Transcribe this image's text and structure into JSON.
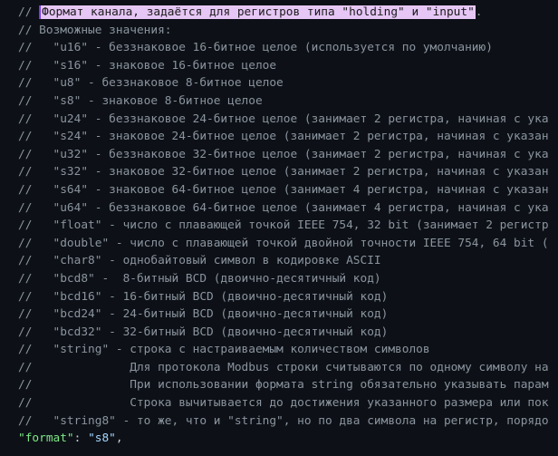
{
  "code": {
    "first_line": {
      "prefix": "// ",
      "highlighted": "Формат канала, задаётся для регистров типа \"holding\" и \"input\"",
      "suffix": "."
    },
    "comment_lines": [
      "// Возможные значения:",
      "//   \"u16\" - беззнаковое 16-битное целое (используется по умолчанию)",
      "//   \"s16\" - знаковое 16-битное целое",
      "//   \"u8\" - беззнаковое 8-битное целое",
      "//   \"s8\" - знаковое 8-битное целое",
      "//   \"u24\" - беззнаковое 24-битное целое (занимает 2 регистра, начиная с ука",
      "//   \"s24\" - знаковое 24-битное целое (занимает 2 регистра, начиная с указан",
      "//   \"u32\" - беззнаковое 32-битное целое (занимает 2 регистра, начиная с ука",
      "//   \"s32\" - знаковое 32-битное целое (занимает 2 регистра, начиная с указан",
      "//   \"s64\" - знаковое 64-битное целое (занимает 4 регистра, начиная с указан",
      "//   \"u64\" - беззнаковое 64-битное целое (занимает 4 регистра, начиная с ука",
      "//   \"float\" - число с плавающей точкой IEEE 754, 32 bit (занимает 2 регистр",
      "//   \"double\" - число с плавающей точкой двойной точности IEEE 754, 64 bit (",
      "//   \"char8\" - однобайтовый символ в кодировке ASCII",
      "//   \"bcd8\" -  8-битный BCD (двоично-десятичный код)",
      "//   \"bcd16\" - 16-битный BCD (двоично-десятичный код)",
      "//   \"bcd24\" - 24-битный BCD (двоично-десятичный код)",
      "//   \"bcd32\" - 32-битный BCD (двоично-десятичный код)",
      "//   \"string\" - строка с настраиваемым количеством символов",
      "//              Для протокола Modbus строки считываются по одному символу на",
      "//              При использовании формата string обязательно указывать парам",
      "//              Строка вычитывается до достижения указанного размера или пок",
      "//   \"string8\" - то же, что и \"string\", но по два символа на регистр, порядо"
    ],
    "last_line": {
      "key": "\"format\"",
      "colon": ": ",
      "value": "\"s8\"",
      "comma": ","
    }
  }
}
